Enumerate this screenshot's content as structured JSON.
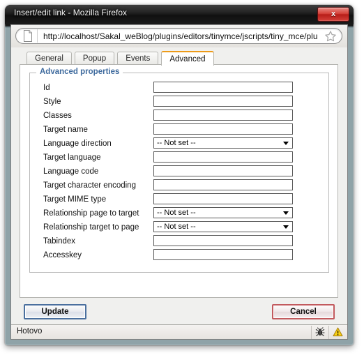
{
  "window": {
    "title": "Insert/edit link - Mozilla Firefox",
    "close_label": "x"
  },
  "browser": {
    "url": "http://localhost/Sakal_weBlog/plugins/editors/tinymce/jscripts/tiny_mce/plu",
    "favicon_name": "page-icon",
    "bookmark_icon_name": "star-icon"
  },
  "dialog": {
    "tabs": [
      {
        "label": "General",
        "active": false
      },
      {
        "label": "Popup",
        "active": false
      },
      {
        "label": "Events",
        "active": false
      },
      {
        "label": "Advanced",
        "active": true
      }
    ],
    "fieldset_legend": "Advanced properties",
    "not_set_option": "-- Not set --",
    "fields": [
      {
        "label": "Id",
        "type": "text",
        "value": ""
      },
      {
        "label": "Style",
        "type": "text",
        "value": ""
      },
      {
        "label": "Classes",
        "type": "text",
        "value": ""
      },
      {
        "label": "Target name",
        "type": "text",
        "value": ""
      },
      {
        "label": "Language direction",
        "type": "select",
        "value": "-- Not set --"
      },
      {
        "label": "Target language",
        "type": "text",
        "value": ""
      },
      {
        "label": "Language code",
        "type": "text",
        "value": ""
      },
      {
        "label": "Target character encoding",
        "type": "text",
        "value": ""
      },
      {
        "label": "Target MIME type",
        "type": "text",
        "value": ""
      },
      {
        "label": "Relationship page to target",
        "type": "select",
        "value": "-- Not set --"
      },
      {
        "label": "Relationship target to page",
        "type": "select",
        "value": "-- Not set --"
      },
      {
        "label": "Tabindex",
        "type": "text",
        "value": ""
      },
      {
        "label": "Accesskey",
        "type": "text",
        "value": ""
      }
    ],
    "buttons": {
      "update_label": "Update",
      "cancel_label": "Cancel"
    }
  },
  "statusbar": {
    "text": "Hotovo",
    "icons": [
      {
        "name": "firebug-bug-icon"
      },
      {
        "name": "warning-triangle-icon"
      }
    ]
  },
  "colors": {
    "active_tab_accent": "#ed9b19",
    "legend_blue": "#3f6b9e",
    "update_border": "#4a6f9e",
    "cancel_border": "#c25a5e",
    "close_red": "#b71d18",
    "warning_yellow": "#f5c211"
  }
}
